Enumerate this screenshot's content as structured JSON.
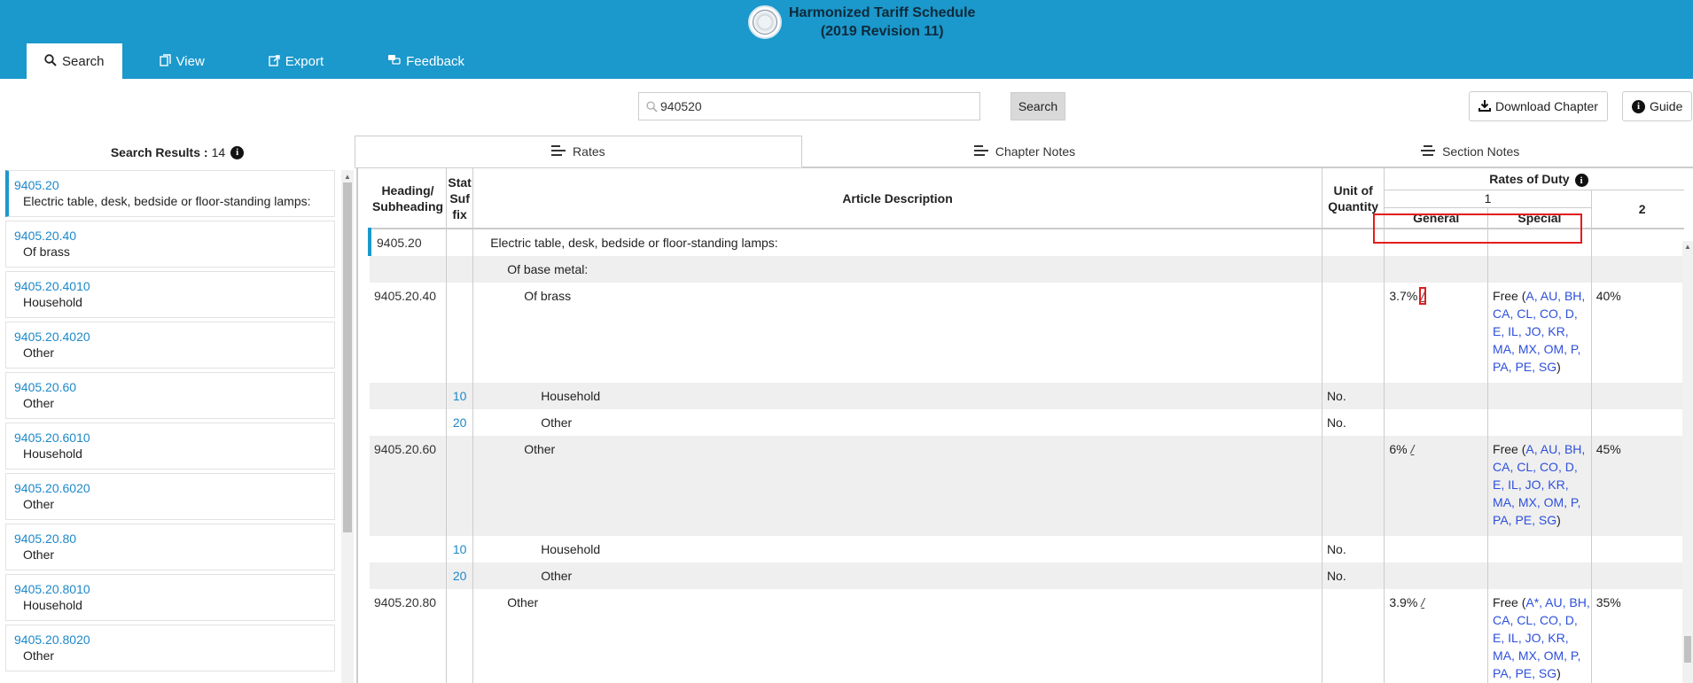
{
  "app": {
    "title_line1": "Harmonized Tariff Schedule",
    "title_line2": "(2019 Revision 11)"
  },
  "nav": [
    {
      "label": "Search",
      "icon": "search-icon",
      "active": true
    },
    {
      "label": "View",
      "icon": "view-icon"
    },
    {
      "label": "Export",
      "icon": "export-icon"
    },
    {
      "label": "Feedback",
      "icon": "feedback-icon"
    }
  ],
  "search": {
    "value": "940520",
    "button_label": "Search"
  },
  "toolbar": {
    "download_label": "Download Chapter",
    "guide_label": "Guide"
  },
  "results": {
    "heading": "Search Results :",
    "count": "14",
    "items": [
      {
        "code": "9405.20",
        "desc": "Electric table, desk, bedside or floor-standing lamps:"
      },
      {
        "code": "9405.20.40",
        "desc": "Of brass"
      },
      {
        "code": "9405.20.4010",
        "desc": "Household"
      },
      {
        "code": "9405.20.4020",
        "desc": "Other"
      },
      {
        "code": "9405.20.60",
        "desc": "Other"
      },
      {
        "code": "9405.20.6010",
        "desc": "Household"
      },
      {
        "code": "9405.20.6020",
        "desc": "Other"
      },
      {
        "code": "9405.20.80",
        "desc": "Other"
      },
      {
        "code": "9405.20.8010",
        "desc": "Household"
      },
      {
        "code": "9405.20.8020",
        "desc": "Other"
      }
    ]
  },
  "tabs": [
    {
      "label": "Rates",
      "active": true
    },
    {
      "label": "Chapter Notes"
    },
    {
      "label": "Section Notes"
    }
  ],
  "table": {
    "headers": {
      "heading": "Heading/ Subheading",
      "stat": "Stat Suf fix",
      "desc": "Article Description",
      "unit": "Unit of Quantity",
      "rates": "Rates of Duty",
      "col1": "1",
      "general": "General",
      "special": "Special",
      "col2": "2"
    },
    "rows": [
      {
        "code": "9405.20",
        "stat": "",
        "desc": "Electric table, desk, bedside or floor-standing lamps:",
        "indent": 0,
        "unit": "",
        "general": "",
        "fn": "",
        "special": "",
        "col2": ""
      },
      {
        "code": "",
        "stat": "",
        "desc": "Of base metal:",
        "indent": 1,
        "unit": "",
        "general": "",
        "fn": "",
        "special": "",
        "col2": ""
      },
      {
        "code": "9405.20.40",
        "stat": "",
        "desc": "Of brass",
        "indent": 2,
        "unit": "",
        "general": "3.7%",
        "fn": "/",
        "special_prefix": "Free (",
        "special_codes": "A, AU, BH, CA, CL, CO, D, E, IL, JO, KR, MA, MX, OM, P, PA, PE, SG",
        "special_suffix": ")",
        "col2": "40%"
      },
      {
        "code": "",
        "stat": "10",
        "desc": "Household",
        "indent": 3,
        "unit": "No.",
        "general": "",
        "fn": "",
        "col2": ""
      },
      {
        "code": "",
        "stat": "20",
        "desc": "Other",
        "indent": 3,
        "unit": "No.",
        "general": "",
        "fn": "",
        "col2": ""
      },
      {
        "code": "9405.20.60",
        "stat": "",
        "desc": "Other",
        "indent": 2,
        "unit": "",
        "general": "6%",
        "fn": "/",
        "special_prefix": "Free (",
        "special_codes": "A, AU, BH, CA, CL, CO, D, E, IL, JO, KR, MA, MX, OM, P, PA, PE, SG",
        "special_suffix": ")",
        "col2": "45%"
      },
      {
        "code": "",
        "stat": "10",
        "desc": "Household",
        "indent": 3,
        "unit": "No.",
        "general": "",
        "fn": "",
        "col2": ""
      },
      {
        "code": "",
        "stat": "20",
        "desc": "Other",
        "indent": 3,
        "unit": "No.",
        "general": "",
        "fn": "",
        "col2": ""
      },
      {
        "code": "9405.20.80",
        "stat": "",
        "desc": "Other",
        "indent": 1,
        "unit": "",
        "general": "3.9%",
        "fn": "/",
        "special_prefix": "Free (",
        "special_codes": "A*, AU, BH, CA, CL, CO, D, E, IL, JO, KR, MA, MX, OM, P, PA, PE, SG",
        "special_suffix": ")",
        "col2": "35%"
      }
    ]
  },
  "colors": {
    "brand": "#1b98cc",
    "link": "#1e88c8",
    "special_link": "#2d4fdc",
    "highlight": "#e21d1d"
  }
}
